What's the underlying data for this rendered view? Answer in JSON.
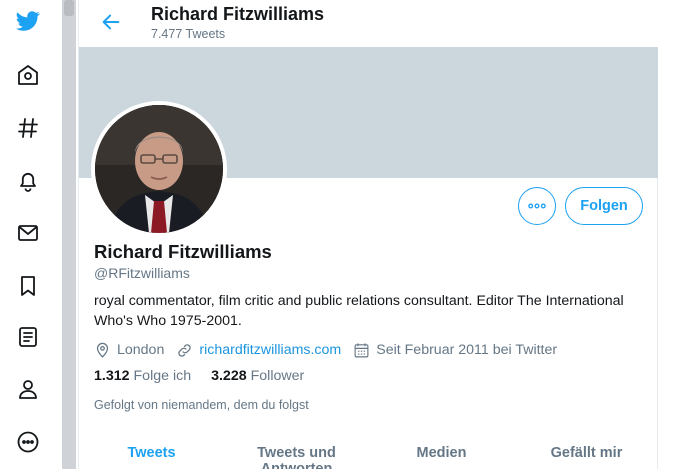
{
  "nav": {
    "icons": [
      "twitter-logo",
      "home-icon",
      "explore-hash-icon",
      "notifications-bell-icon",
      "messages-envelope-icon",
      "bookmarks-icon",
      "lists-icon",
      "profile-icon",
      "more-icon"
    ]
  },
  "header": {
    "name": "Richard Fitzwilliams",
    "tweet_count": "7.477 Tweets"
  },
  "profile": {
    "name": "Richard Fitzwilliams",
    "handle": "@RFitzwilliams",
    "bio": "royal commentator, film critic and public relations consultant. Editor The International Who's Who 1975-2001.",
    "location": "London",
    "website": "richardfitzwilliams.com",
    "joined": "Seit Februar 2011 bei Twitter",
    "following_count": "1.312",
    "following_label": "Folge ich",
    "followers_count": "3.228",
    "followers_label": "Follower",
    "followed_by": "Gefolgt von niemandem, dem du folgst",
    "follow_button": "Folgen"
  },
  "tabs": [
    {
      "label": "Tweets",
      "active": true
    },
    {
      "label": "Tweets und Antworten",
      "active": false
    },
    {
      "label": "Medien",
      "active": false
    },
    {
      "label": "Gefällt mir",
      "active": false
    }
  ],
  "colors": {
    "accent": "#1da1f2",
    "banner": "#ccd6dd",
    "text": "#14171a",
    "muted": "#657786"
  }
}
